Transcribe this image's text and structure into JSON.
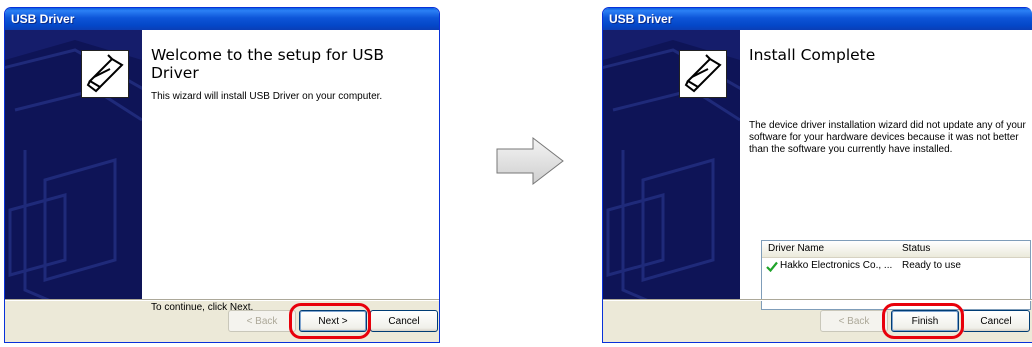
{
  "left_window": {
    "title": "USB Driver",
    "heading": "Welcome to the setup for USB Driver",
    "description": "This wizard will install USB Driver on your computer.",
    "instruction": "To continue, click Next.",
    "buttons": {
      "back": "< Back",
      "next": "Next >",
      "cancel": "Cancel"
    }
  },
  "right_window": {
    "title": "USB Driver",
    "heading": "Install Complete",
    "description": "The device driver installation wizard did not update any of your software for your hardware devices because it was not better than the software you currently have installed.",
    "driver_list": {
      "columns": [
        "Driver Name",
        "Status"
      ],
      "rows": [
        {
          "name": "Hakko Electronics Co., ...",
          "status": "Ready to use"
        }
      ]
    },
    "buttons": {
      "back": "< Back",
      "finish": "Finish",
      "cancel": "Cancel"
    }
  },
  "colors": {
    "titlebar": "#0a53d6",
    "side_panel": "#0e1457",
    "highlight": "#e8000b",
    "success_check": "#1fa32a"
  },
  "icons": [
    "arrow-right-icon",
    "usb-device-icon",
    "checkmark-icon"
  ]
}
